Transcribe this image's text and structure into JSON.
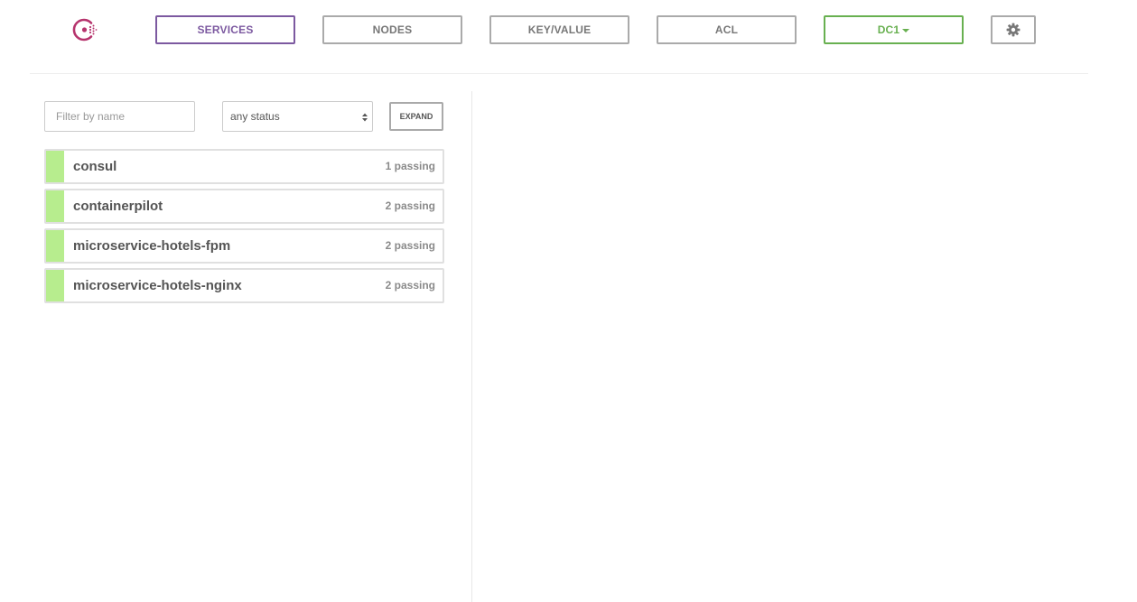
{
  "nav": {
    "logo_icon": "consul-logo-icon",
    "services_label": "SERVICES",
    "nodes_label": "NODES",
    "kv_label": "KEY/VALUE",
    "acl_label": "ACL",
    "datacenter_label": "DC1",
    "settings_icon": "gear-icon"
  },
  "filters": {
    "name_placeholder": "Filter by name",
    "name_value": "",
    "status_selected": "any status",
    "expand_label": "EXPAND"
  },
  "services": [
    {
      "name": "consul",
      "status": "1 passing"
    },
    {
      "name": "containerpilot",
      "status": "2 passing"
    },
    {
      "name": "microservice-hotels-fpm",
      "status": "2 passing"
    },
    {
      "name": "microservice-hotels-nginx",
      "status": "2 passing"
    }
  ],
  "colors": {
    "accent": "#7c59a0",
    "datacenter": "#68b050",
    "passing": "#b7ed8e",
    "logo": "#b6346d"
  }
}
